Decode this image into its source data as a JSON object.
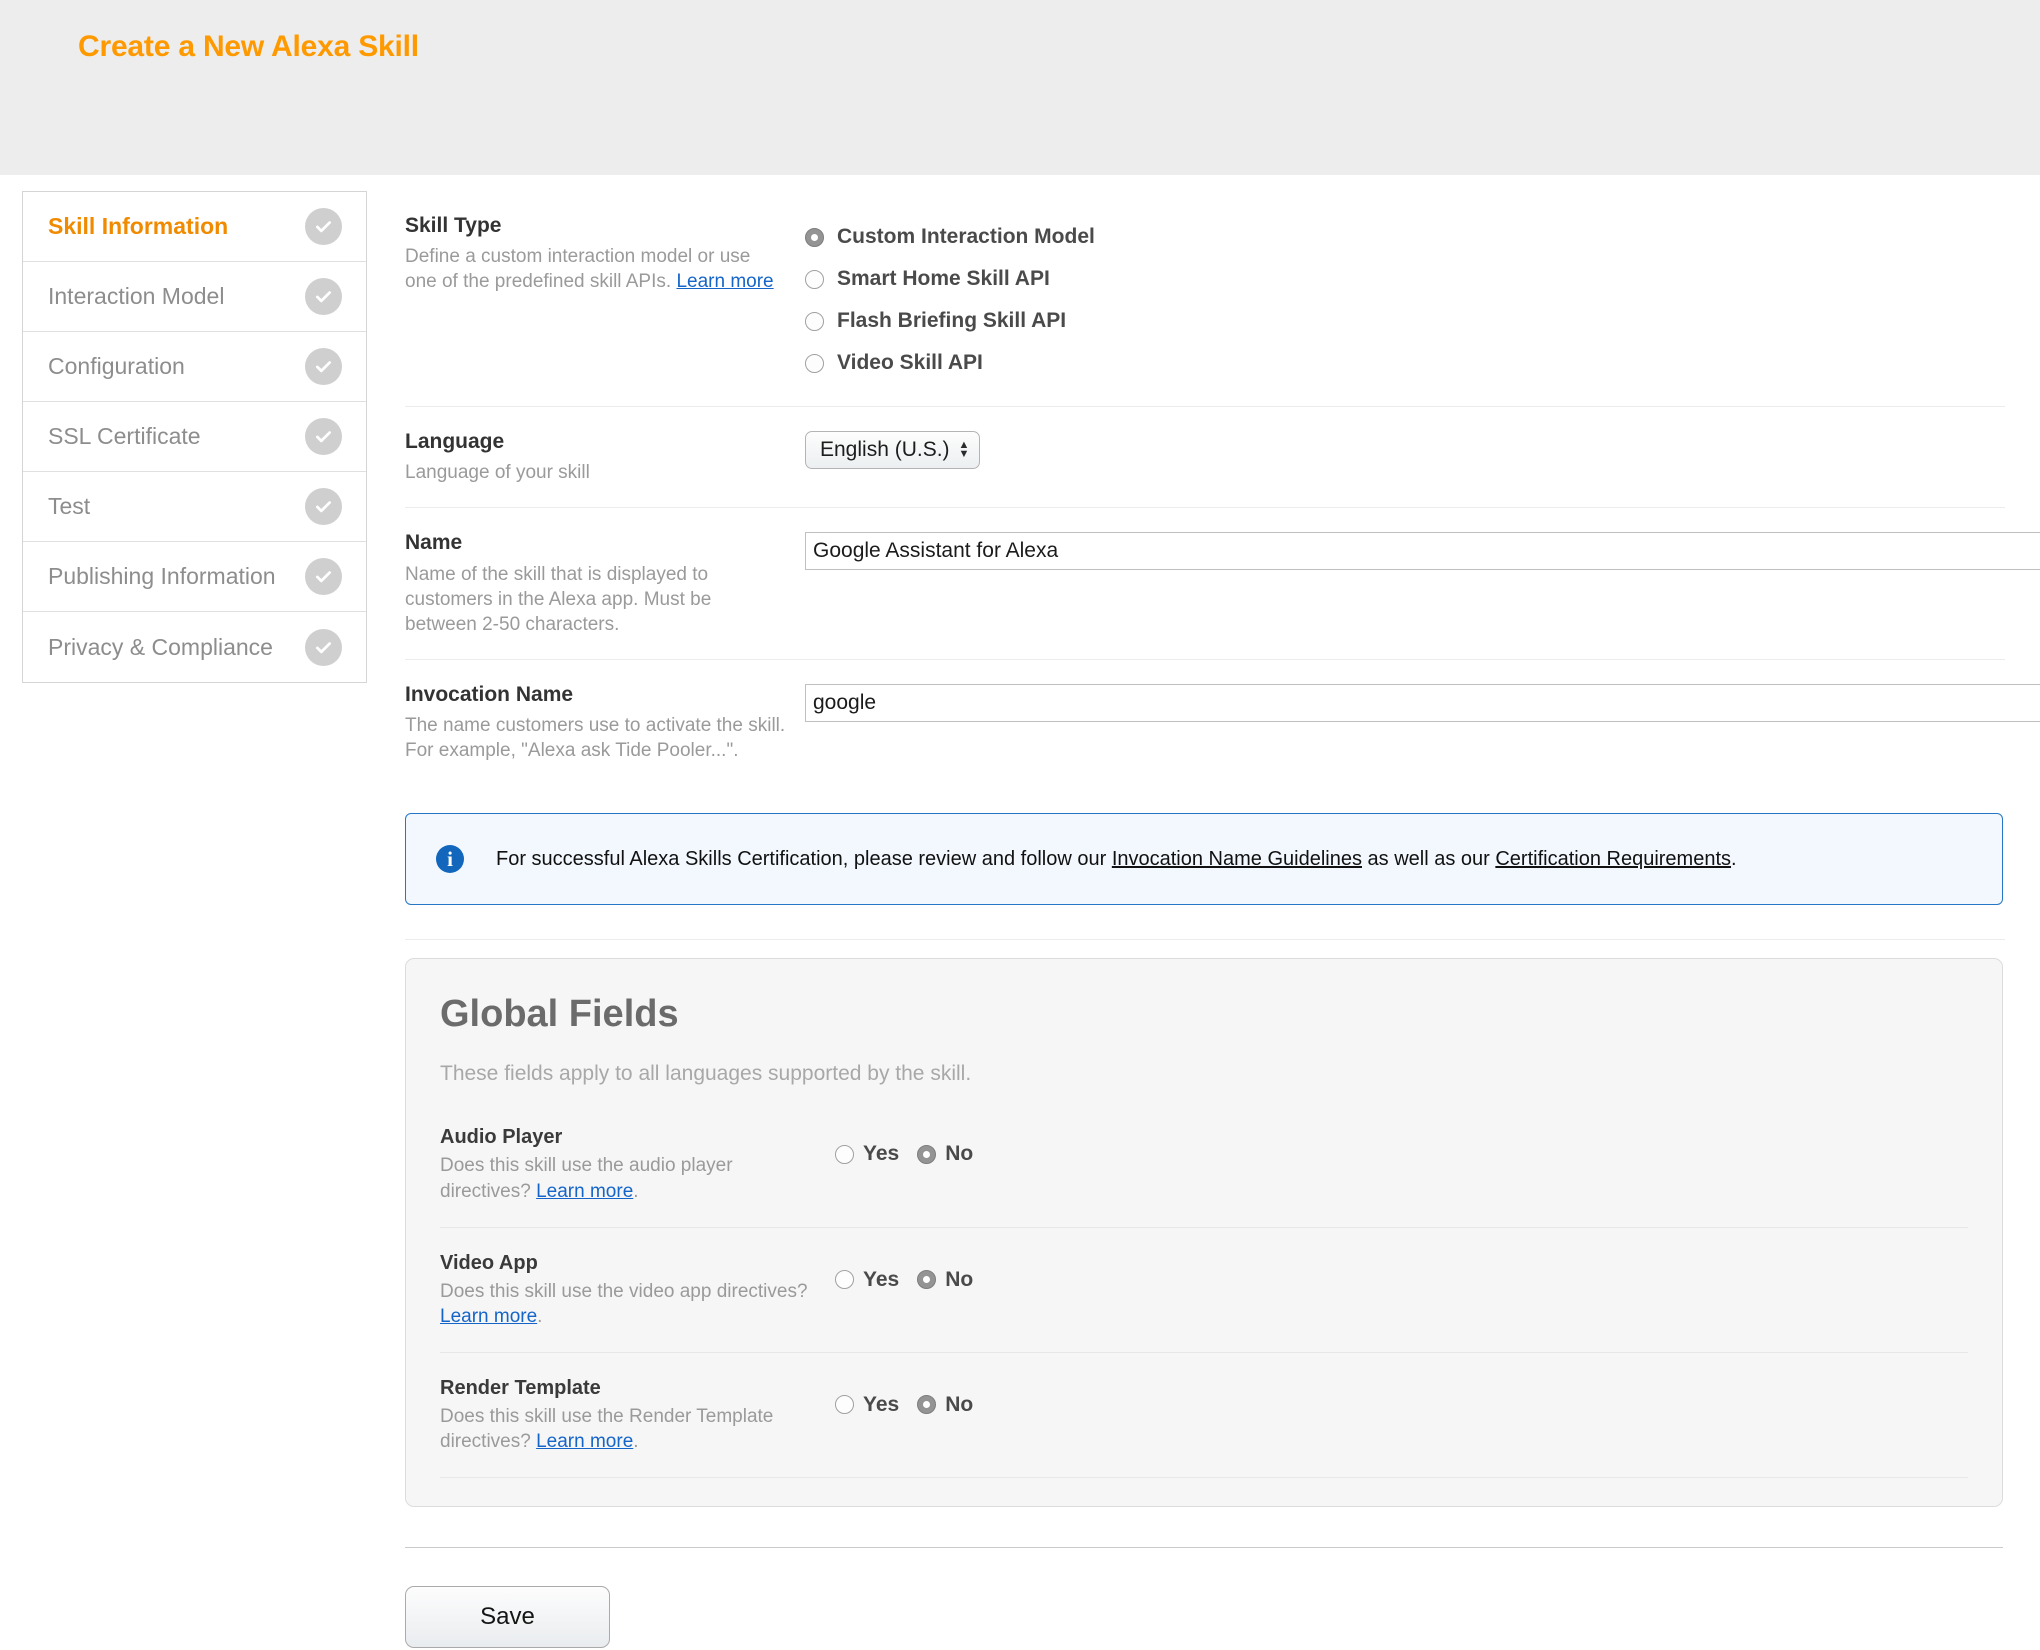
{
  "header": {
    "title": "Create a New Alexa Skill",
    "accent_color": "#ff9900",
    "band_color": "#ededed"
  },
  "sidebar": {
    "items": [
      {
        "label": "Skill Information",
        "active": true,
        "checked": true
      },
      {
        "label": "Interaction Model",
        "active": false,
        "checked": true
      },
      {
        "label": "Configuration",
        "active": false,
        "checked": true
      },
      {
        "label": "SSL Certificate",
        "active": false,
        "checked": true
      },
      {
        "label": "Test",
        "active": false,
        "checked": true
      },
      {
        "label": "Publishing Information",
        "active": false,
        "checked": true
      },
      {
        "label": "Privacy & Compliance",
        "active": false,
        "checked": true
      }
    ]
  },
  "skill_type": {
    "title": "Skill Type",
    "description": "Define a custom interaction model or use one of the predefined skill APIs.",
    "learn_more": "Learn more",
    "options": [
      {
        "label": "Custom Interaction Model",
        "selected": true
      },
      {
        "label": "Smart Home Skill API",
        "selected": false
      },
      {
        "label": "Flash Briefing Skill API",
        "selected": false
      },
      {
        "label": "Video Skill API",
        "selected": false
      }
    ]
  },
  "language": {
    "title": "Language",
    "description": "Language of your skill",
    "selected": "English (U.S.)"
  },
  "name": {
    "title": "Name",
    "description": "Name of the skill that is displayed to customers in the Alexa app. Must be between 2-50 characters.",
    "value": "Google Assistant for Alexa",
    "placeholder": ""
  },
  "invocation_name": {
    "title": "Invocation Name",
    "description": "The name customers use to activate the skill. For example, \"Alexa ask Tide Pooler...\".",
    "value": "google",
    "placeholder": ""
  },
  "info_banner": {
    "icon": "info-icon",
    "text_before": "For successful Alexa Skills Certification, please review and follow our ",
    "link1": "Invocation Name Guidelines",
    "text_middle": " as well as our ",
    "link2": "Certification Requirements",
    "text_after": ".",
    "border_color": "#2676c6",
    "background_color": "#f2f8fe"
  },
  "global_fields": {
    "title": "Global Fields",
    "subtitle": "These fields apply to all languages supported by the skill.",
    "yes_label": "Yes",
    "no_label": "No",
    "rows": [
      {
        "title": "Audio Player",
        "desc_before": "Does this skill use the audio player directives? ",
        "link": "Learn more",
        "desc_after": ".",
        "yes_selected": false,
        "no_selected": true
      },
      {
        "title": "Video App",
        "desc_before": "Does this skill use the video app directives? ",
        "link": "Learn more",
        "desc_after": ".",
        "yes_selected": false,
        "no_selected": true
      },
      {
        "title": "Render Template",
        "desc_before": "Does this skill use the Render Template directives? ",
        "link": "Learn more",
        "desc_after": ".",
        "yes_selected": false,
        "no_selected": true
      }
    ]
  },
  "footer": {
    "save_label": "Save"
  }
}
